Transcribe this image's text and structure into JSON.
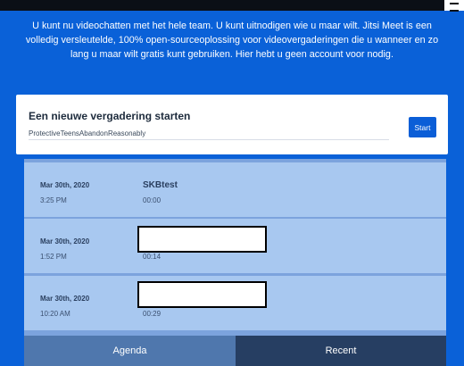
{
  "intro": {
    "text": "U kunt nu videochatten met het hele team. U kunt uitnodigen wie u maar wilt. Jitsi Meet is een volledig versleutelde, 100% open-sourceoplossing voor videovergaderingen die u wanneer en zo lang u maar wilt gratis kunt gebruiken. Hier hebt u geen account voor nodig."
  },
  "new_meeting": {
    "title": "Een nieuwe vergadering starten",
    "room_name_value": "ProtectiveTeensAbandonReasonably",
    "start_label": "Start"
  },
  "recent_meetings": [
    {
      "date": "Mar 30th, 2020",
      "time": "3:25 PM",
      "name": "SKBtest",
      "duration": "00:00"
    },
    {
      "date": "Mar 30th, 2020",
      "time": "1:52 PM",
      "name": "",
      "duration": "00:14"
    },
    {
      "date": "Mar 30th, 2020",
      "time": "10:20 AM",
      "name": "",
      "duration": "00:29"
    }
  ],
  "tabs": {
    "agenda_label": "Agenda",
    "recent_label": "Recent"
  },
  "colors": {
    "background": "#0a61d8",
    "card": "#ffffff",
    "start_button": "#0b5ed7",
    "row": "#a8c8f0",
    "tab_agenda": "#4f77ad",
    "tab_recent_active": "#263e62"
  }
}
